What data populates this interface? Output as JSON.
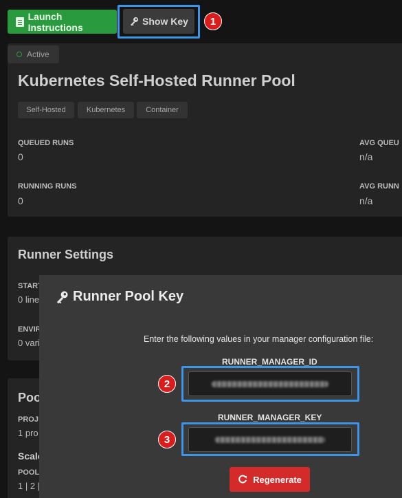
{
  "toolbar": {
    "launch_label": "Launch Instructions",
    "show_key_label": "Show Key"
  },
  "markers": [
    "1",
    "2",
    "3"
  ],
  "pool": {
    "status": "Active",
    "title": "Kubernetes Self-Hosted Runner Pool",
    "tags": [
      "Self-Hosted",
      "Kubernetes",
      "Container"
    ],
    "stats": [
      {
        "label": "QUEUED RUNS",
        "value": "0"
      },
      {
        "label": "AVG QUEU",
        "value": "n/a"
      },
      {
        "label": "RUNNING RUNS",
        "value": "0"
      },
      {
        "label": "AVG RUNN",
        "value": "n/a"
      }
    ]
  },
  "runner_settings": {
    "title": "Runner Settings",
    "start_label": "START",
    "start_value": "0 line",
    "env_label": "ENVIR",
    "env_value": "0 vari"
  },
  "pool_section": {
    "title": "Poo",
    "projects_label": "PROJ",
    "projects_value": "1 pro",
    "scale_title": "Scale",
    "pool_label": "POOL",
    "pool_value": "1 | 2 |"
  },
  "modal": {
    "title": "Runner Pool Key",
    "instructions": "Enter the following values in your manager configuration file:",
    "id_label": "RUNNER_MANAGER_ID",
    "key_label": "RUNNER_MANAGER_KEY",
    "regenerate_label": "Regenerate"
  },
  "colors": {
    "accent_green": "#2a9a3f",
    "danger_red": "#d42a2a",
    "highlight_blue": "#3d94e8"
  }
}
